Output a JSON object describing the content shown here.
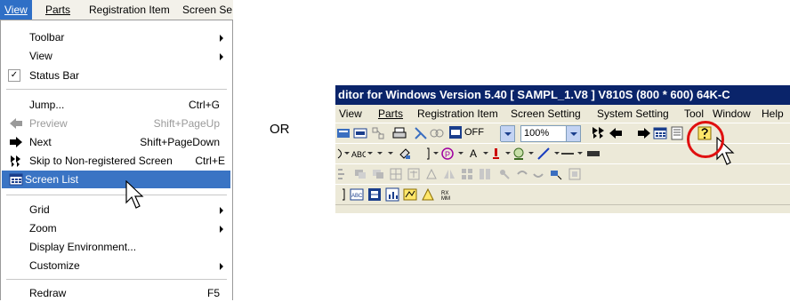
{
  "menubar": {
    "items": [
      "View",
      "Parts",
      "Registration Item",
      "Screen Se"
    ]
  },
  "view_menu": {
    "toolbar": {
      "label": "Toolbar"
    },
    "view": {
      "label": "View"
    },
    "status_bar": {
      "label": "Status Bar",
      "checked": true,
      "check_glyph": "✓"
    },
    "jump": {
      "label": "Jump...",
      "shortcut": "Ctrl+G"
    },
    "preview": {
      "label": "Preview",
      "shortcut": "Shift+PageUp"
    },
    "next": {
      "label": "Next",
      "shortcut": "Shift+PageDown"
    },
    "skip": {
      "label": "Skip to Non-registered Screen",
      "shortcut": "Ctrl+E"
    },
    "screen_list": {
      "label": "Screen List"
    },
    "grid": {
      "label": "Grid"
    },
    "zoom": {
      "label": "Zoom"
    },
    "display_environment": {
      "label": "Display Environment..."
    },
    "customize": {
      "label": "Customize"
    },
    "redraw": {
      "label": "Redraw",
      "shortcut": "F5"
    }
  },
  "or_text": "OR",
  "editor": {
    "title": "ditor for Windows Version 5.40 [ SAMPL_1.V8 ] V810S (800 * 600) 64K-C",
    "menu": [
      "View",
      "Parts",
      "Registration Item",
      "Screen Setting",
      "System Setting",
      "Tool",
      "Window",
      "Help"
    ],
    "toolbar": {
      "off_value": "OFF",
      "zoom_value": "100%"
    }
  },
  "colors": {
    "menu_highlight": "#3a74c4",
    "title_bar": "#0a246a",
    "callout_circle": "#e01010",
    "toolbar_bg": "#ece9d8"
  }
}
